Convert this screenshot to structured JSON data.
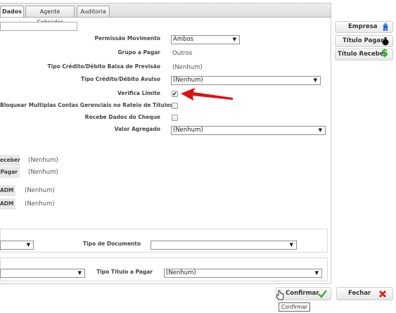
{
  "tabs": [
    {
      "label": "Dados",
      "active": true
    },
    {
      "label": "Agente Cobrador",
      "active": false
    },
    {
      "label": "Auditoria",
      "active": false
    }
  ],
  "form": {
    "permissao_movimento": {
      "label": "Permissão Movimento",
      "value": "Ambos"
    },
    "grupo_a_pagar": {
      "label": "Grupo a Pagar",
      "value": "Outros"
    },
    "tipo_baixa_previsao": {
      "label": "Tipo Crédito/Débito Baixa de Previsão",
      "value": "(Nenhum)"
    },
    "tipo_avulso": {
      "label": "Tipo Crédito/Débito Avulso",
      "value": "(Nenhum)"
    },
    "verifica_limite": {
      "label": "Verifica Limite",
      "checked": true
    },
    "bloquear_multiplas": {
      "label": "Bloquear Multiplas Contas Gerenciais no Rateio de Títulos",
      "checked": false
    },
    "recebe_dados_cheque": {
      "label": "Recebe Dados do Cheque",
      "checked": false
    },
    "valor_agregado": {
      "label": "Valor Agregado",
      "value": "(Nenhum)"
    }
  },
  "left_fields": [
    {
      "tag": "eceber",
      "value": "(Nenhum)"
    },
    {
      "tag": "Pagar",
      "value": "(Nenhum)"
    },
    {
      "tag": "ADM",
      "value": "(Nenhum)"
    },
    {
      "tag": "ADM",
      "value": "(Nenhum)"
    }
  ],
  "documento": {
    "label": "Tipo de Documento",
    "value": ""
  },
  "titulo_pagar": {
    "label": "Tipo Título a Pagar",
    "value": "(Nenhum)"
  },
  "side_buttons": [
    {
      "label": "Empresa",
      "icon": "building-icon",
      "color": "#2b5fc9"
    },
    {
      "label": "Título Pagar",
      "icon": "money-bag-icon",
      "color": "#111111"
    },
    {
      "label": "Título Receber",
      "icon": "dollar-sign-icon",
      "color": "#2aa52a"
    }
  ],
  "actions": {
    "confirm": "Confirmar",
    "close": "Fechar",
    "tooltip": "Confirmar"
  },
  "colors": {
    "arrow": "#e01010",
    "confirm_check": "#3cb33c",
    "close_x": "#d42020"
  }
}
